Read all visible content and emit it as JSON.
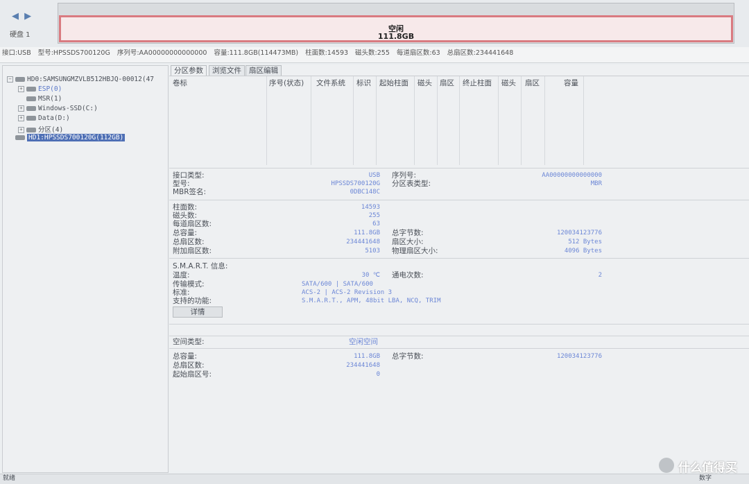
{
  "top": {
    "nav_arrows": "◀ ▶",
    "disk_label": "硬盘 1",
    "partition_name": "空闲",
    "partition_size": "111.8GB"
  },
  "infobar": {
    "interface": "接口:USB",
    "model": "型号:HPSSDS700120G",
    "serial": "序列号:AA00000000000000",
    "capacity": "容量:111.8GB(114473MB)",
    "cylinders": "柱面数:14593",
    "heads": "磁头数:255",
    "sectors_per_track": "每道扇区数:63",
    "total_sectors": "总扇区数:234441648"
  },
  "tree": {
    "hd0": "HD0:SAMSUNGMZVLB512HBJQ-00012(47",
    "items": [
      "ESP(0)",
      "MSR(1)",
      "Windows-SSD(C:)",
      "Data(D:)",
      "分区(4)"
    ],
    "hd1": "HD1:HPSSDS700120G(112GB)"
  },
  "tabs": [
    "分区参数",
    "浏览文件",
    "扇区编辑"
  ],
  "grid_headers": [
    "卷标",
    "序号(状态)",
    "文件系统",
    "标识",
    "起始柱面",
    "磁头",
    "扇区",
    "终止柱面",
    "磁头",
    "扇区",
    "容量"
  ],
  "info1": {
    "interface_type_label": "接口类型:",
    "interface_type": "USB",
    "model_label": "型号:",
    "model": "HPSSDS700120G",
    "mbr_sig_label": "MBR签名:",
    "mbr_sig": "0DBC148C",
    "serial_label": "序列号:",
    "serial": "AA00000000000000",
    "pt_type_label": "分区表类型:",
    "pt_type": "MBR"
  },
  "info2": {
    "cyl_label": "柱面数:",
    "cyl": "14593",
    "heads_label": "磁头数:",
    "heads": "255",
    "spt_label": "每道扇区数:",
    "spt": "63",
    "cap_label": "总容量:",
    "cap": "111.8GB",
    "tsec_label": "总扇区数:",
    "tsec": "234441648",
    "extra_label": "附加扇区数:",
    "extra": "5103",
    "bytes_label": "总字节数:",
    "bytes": "120034123776",
    "secsize_label": "扇区大小:",
    "secsize": "512 Bytes",
    "physsec_label": "物理扇区大小:",
    "physsec": "4096 Bytes"
  },
  "smart": {
    "title": "S.M.A.R.T. 信息:",
    "temp_label": "温度:",
    "temp": "30 ℃",
    "mode_label": "传输模式:",
    "mode": "SATA/600 | SATA/600",
    "std_label": "标准:",
    "std": "ACS-2 | ACS-2 Revision 3",
    "feat_label": "支持的功能:",
    "feat": "S.M.A.R.T., APM, 48bit LBA, NCQ, TRIM",
    "power_label": "通电次数:",
    "power": "2",
    "detail_button": "详情"
  },
  "space": {
    "type_label": "空间类型:",
    "type": "空闲空间",
    "cap_label": "总容量:",
    "cap": "111.8GB",
    "tsec_label": "总扇区数:",
    "tsec": "234441648",
    "start_label": "起始扇区号:",
    "start": "0",
    "bytes_label": "总字节数:",
    "bytes": "120034123776"
  },
  "status": {
    "left": "就绪",
    "right": "数字"
  },
  "watermark": "什么值得买"
}
